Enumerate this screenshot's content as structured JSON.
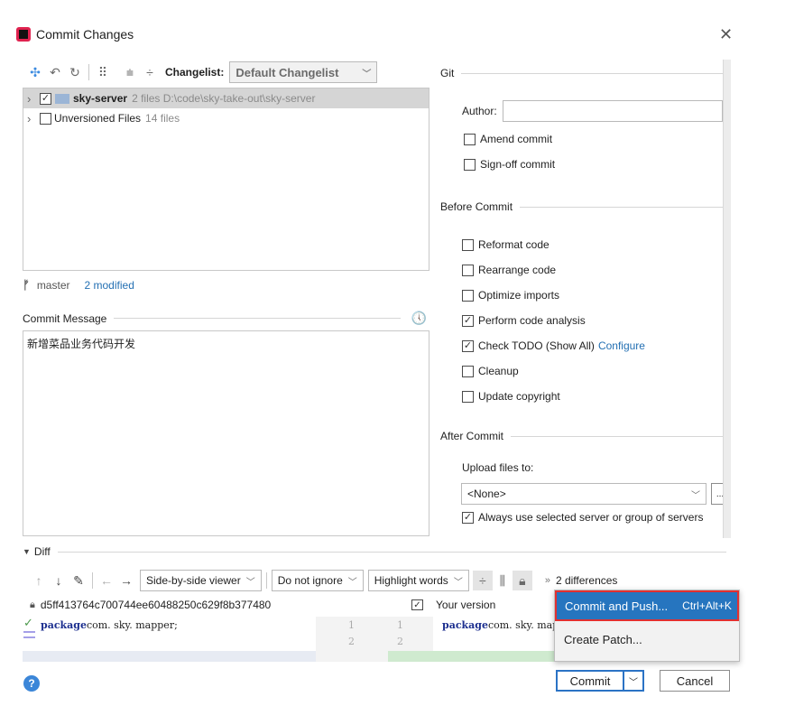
{
  "window": {
    "title": "Commit Changes"
  },
  "toolbar": {
    "changelist_label": "Changelist:",
    "changelist_value": "Default Changelist"
  },
  "tree": {
    "items": [
      {
        "name": "sky-server",
        "meta": "2 files  D:\\code\\sky-take-out\\sky-server",
        "checked": true
      },
      {
        "name": "Unversioned Files",
        "meta": "14 files",
        "checked": false
      }
    ]
  },
  "branch": {
    "name": "master",
    "modified": "2 modified"
  },
  "commit_message": {
    "label": "Commit Message",
    "text": "新增菜品业务代码开发"
  },
  "git": {
    "section": "Git",
    "author_label": "Author:",
    "author_value": "",
    "amend": "Amend commit",
    "signoff": "Sign-off commit"
  },
  "before_commit": {
    "section": "Before Commit",
    "options": [
      {
        "label": "Reformat code",
        "checked": false
      },
      {
        "label": "Rearrange code",
        "checked": false
      },
      {
        "label": "Optimize imports",
        "checked": false
      },
      {
        "label": "Perform code analysis",
        "checked": true
      },
      {
        "label": "Check TODO (Show All)",
        "checked": true,
        "link": "Configure"
      },
      {
        "label": "Cleanup",
        "checked": false
      },
      {
        "label": "Update copyright",
        "checked": false
      }
    ]
  },
  "after_commit": {
    "section": "After Commit",
    "upload_label": "Upload files to:",
    "upload_value": "<None>",
    "always_use": "Always use selected server or group of servers"
  },
  "diff": {
    "label": "Diff",
    "viewer": "Side-by-side viewer",
    "ignore": "Do not ignore",
    "highlight": "Highlight words",
    "differences": "2 differences",
    "left_hash": "d5ff413764c700744ee60488250c629f8b377480",
    "right_label": "Your version",
    "left_code_kw": "package",
    "left_code": " com. sky. mapper;",
    "right_code_kw": "package",
    "right_code": " com. sky. mapper;",
    "line1": "1",
    "line2": "2"
  },
  "popup": {
    "items": [
      {
        "label": "Commit and Push...",
        "shortcut": "Ctrl+Alt+K"
      },
      {
        "label": "Create Patch...",
        "shortcut": ""
      }
    ]
  },
  "buttons": {
    "commit": "Commit",
    "cancel": "Cancel",
    "help": "?"
  },
  "colors": {
    "link": "#2470b3",
    "popup_highlight": "#2675bf",
    "selected_row": "#d5d5d5",
    "red_frame": "#e23030"
  }
}
